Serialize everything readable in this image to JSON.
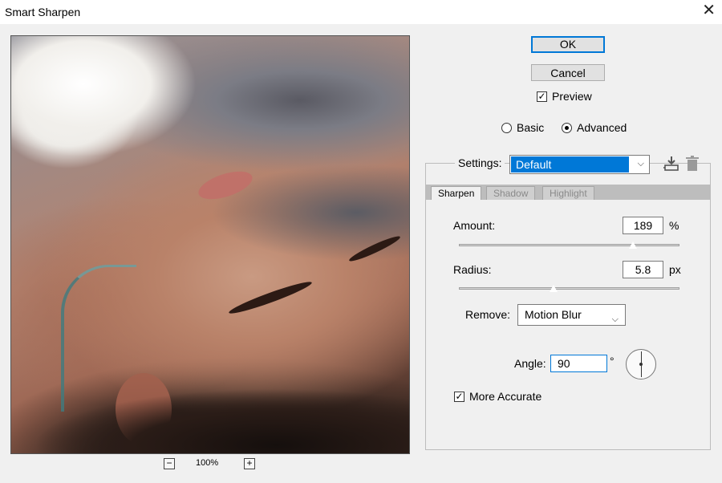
{
  "window": {
    "title": "Smart Sharpen",
    "close_glyph": "✕"
  },
  "preview": {
    "zoom_out": "−",
    "zoom_level": "100%",
    "zoom_in": "+"
  },
  "buttons": {
    "ok": "OK",
    "cancel": "Cancel"
  },
  "preview_toggle": {
    "label": "Preview",
    "checked": true,
    "check_glyph": "✓"
  },
  "mode": {
    "basic": "Basic",
    "advanced": "Advanced",
    "selected": "Advanced"
  },
  "settings": {
    "label": "Settings:",
    "value": "Default",
    "save_icon": "save-preset-icon",
    "delete_icon": "trash-icon"
  },
  "tabs": [
    {
      "label": "Sharpen",
      "active": true
    },
    {
      "label": "Shadow",
      "active": false
    },
    {
      "label": "Highlight",
      "active": false
    }
  ],
  "amount": {
    "label": "Amount:",
    "value": "189",
    "unit": "%",
    "slider_fraction": 0.79
  },
  "radius": {
    "label": "Radius:",
    "value": "5.8",
    "unit": "px",
    "slider_fraction": 0.43
  },
  "remove": {
    "label": "Remove:",
    "value": "Motion Blur"
  },
  "angle": {
    "label": "Angle:",
    "value": "90",
    "unit": "°"
  },
  "more_accurate": {
    "label": "More Accurate",
    "checked": true,
    "check_glyph": "✓"
  },
  "chevron_glyph": "⌵",
  "colors": {
    "accent": "#0078d7",
    "dialog_bg": "#f0f0f0"
  }
}
